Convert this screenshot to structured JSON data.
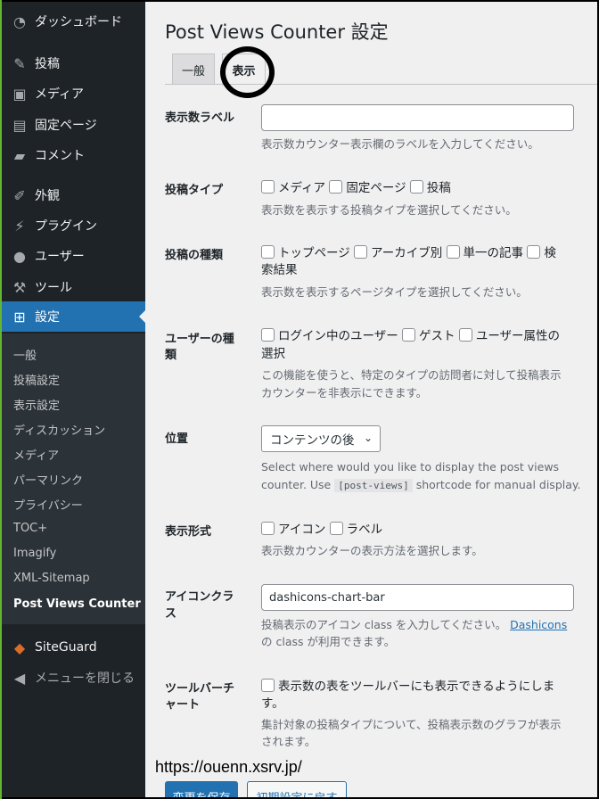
{
  "sidebar": {
    "items": [
      {
        "label": "ダッシュボード",
        "icon": "dashboard-icon",
        "glyph": "◔"
      },
      {
        "label": "投稿",
        "icon": "pin-icon",
        "glyph": "✎"
      },
      {
        "label": "メディア",
        "icon": "media-icon",
        "glyph": "▣"
      },
      {
        "label": "固定ページ",
        "icon": "page-icon",
        "glyph": "▤"
      },
      {
        "label": "コメント",
        "icon": "comment-icon",
        "glyph": "▰"
      },
      {
        "label": "外観",
        "icon": "appearance-icon",
        "glyph": "✐"
      },
      {
        "label": "プラグイン",
        "icon": "plugin-icon",
        "glyph": "⚡"
      },
      {
        "label": "ユーザー",
        "icon": "user-icon",
        "glyph": "●"
      },
      {
        "label": "ツール",
        "icon": "tool-icon",
        "glyph": "⚒"
      },
      {
        "label": "設定",
        "icon": "settings-icon",
        "glyph": "⊞"
      }
    ],
    "submenu": [
      "一般",
      "投稿設定",
      "表示設定",
      "ディスカッション",
      "メディア",
      "パーマリンク",
      "プライバシー",
      "TOC+",
      "Imagify",
      "XML-Sitemap",
      "Post Views Counter"
    ],
    "siteguard": {
      "label": "SiteGuard",
      "glyph": "◆"
    },
    "collapse": {
      "label": "メニューを閉じる",
      "glyph": "◀"
    }
  },
  "page": {
    "title": "Post Views Counter 設定",
    "tabs": [
      "一般",
      "表示"
    ]
  },
  "fields": {
    "label_field": {
      "label": "表示数ラベル",
      "value": "",
      "desc": "表示数カウンター表示欄のラベルを入力してください。"
    },
    "post_types": {
      "label": "投稿タイプ",
      "options": [
        "メディア",
        "固定ページ",
        "投稿"
      ],
      "desc": "表示数を表示する投稿タイプを選択してください。"
    },
    "page_types": {
      "label": "投稿の種類",
      "line1": "トップページ",
      "line1b": "アーカイブ別",
      "line1c": "単一の記事",
      "line1d": "検",
      "line2": "索結果",
      "desc": "表示数を表示するページタイプを選択してください。"
    },
    "user_type": {
      "label1": "ユーザーの種",
      "label2": "類",
      "opt1": "ログイン中のユーザー",
      "opt2": "ゲスト",
      "opt3": "ユーザー属性の",
      "opt4": "選択",
      "desc1": "この機能を使うと、特定のタイプの訪問者に対して投稿表示",
      "desc2": "カウンターを非表示にできます。"
    },
    "position": {
      "label": "位置",
      "value": "コンテンツの後",
      "desc1": "Select where would you like to display the post views",
      "desc2a": "counter. Use",
      "code": "[post-views]",
      "desc2b": "shortcode for manual display."
    },
    "display_style": {
      "label": "表示形式",
      "opt1": "アイコン",
      "opt2": "ラベル",
      "desc": "表示数カウンターの表示方法を選択します。"
    },
    "icon_class": {
      "label1": "アイコンクラ",
      "label2": "ス",
      "value": "dashicons-chart-bar",
      "desc1": "投稿表示のアイコン class を入力してください。",
      "link": "Dashicons",
      "desc2": "の class が利用できます。"
    },
    "toolbar": {
      "label1": "ツールバーチ",
      "label2": "ャート",
      "opt1": "表示数の表をツールバーにも表示できるようにしま",
      "opt2": "す。",
      "desc1": "集計対象の投稿タイプについて、投稿表示数のグラフが表示",
      "desc2": "されます。"
    }
  },
  "footer": {
    "save": "変更を保存",
    "reset": "初期設定に戻す"
  },
  "watermark": "https://ouenn.xsrv.jp/"
}
